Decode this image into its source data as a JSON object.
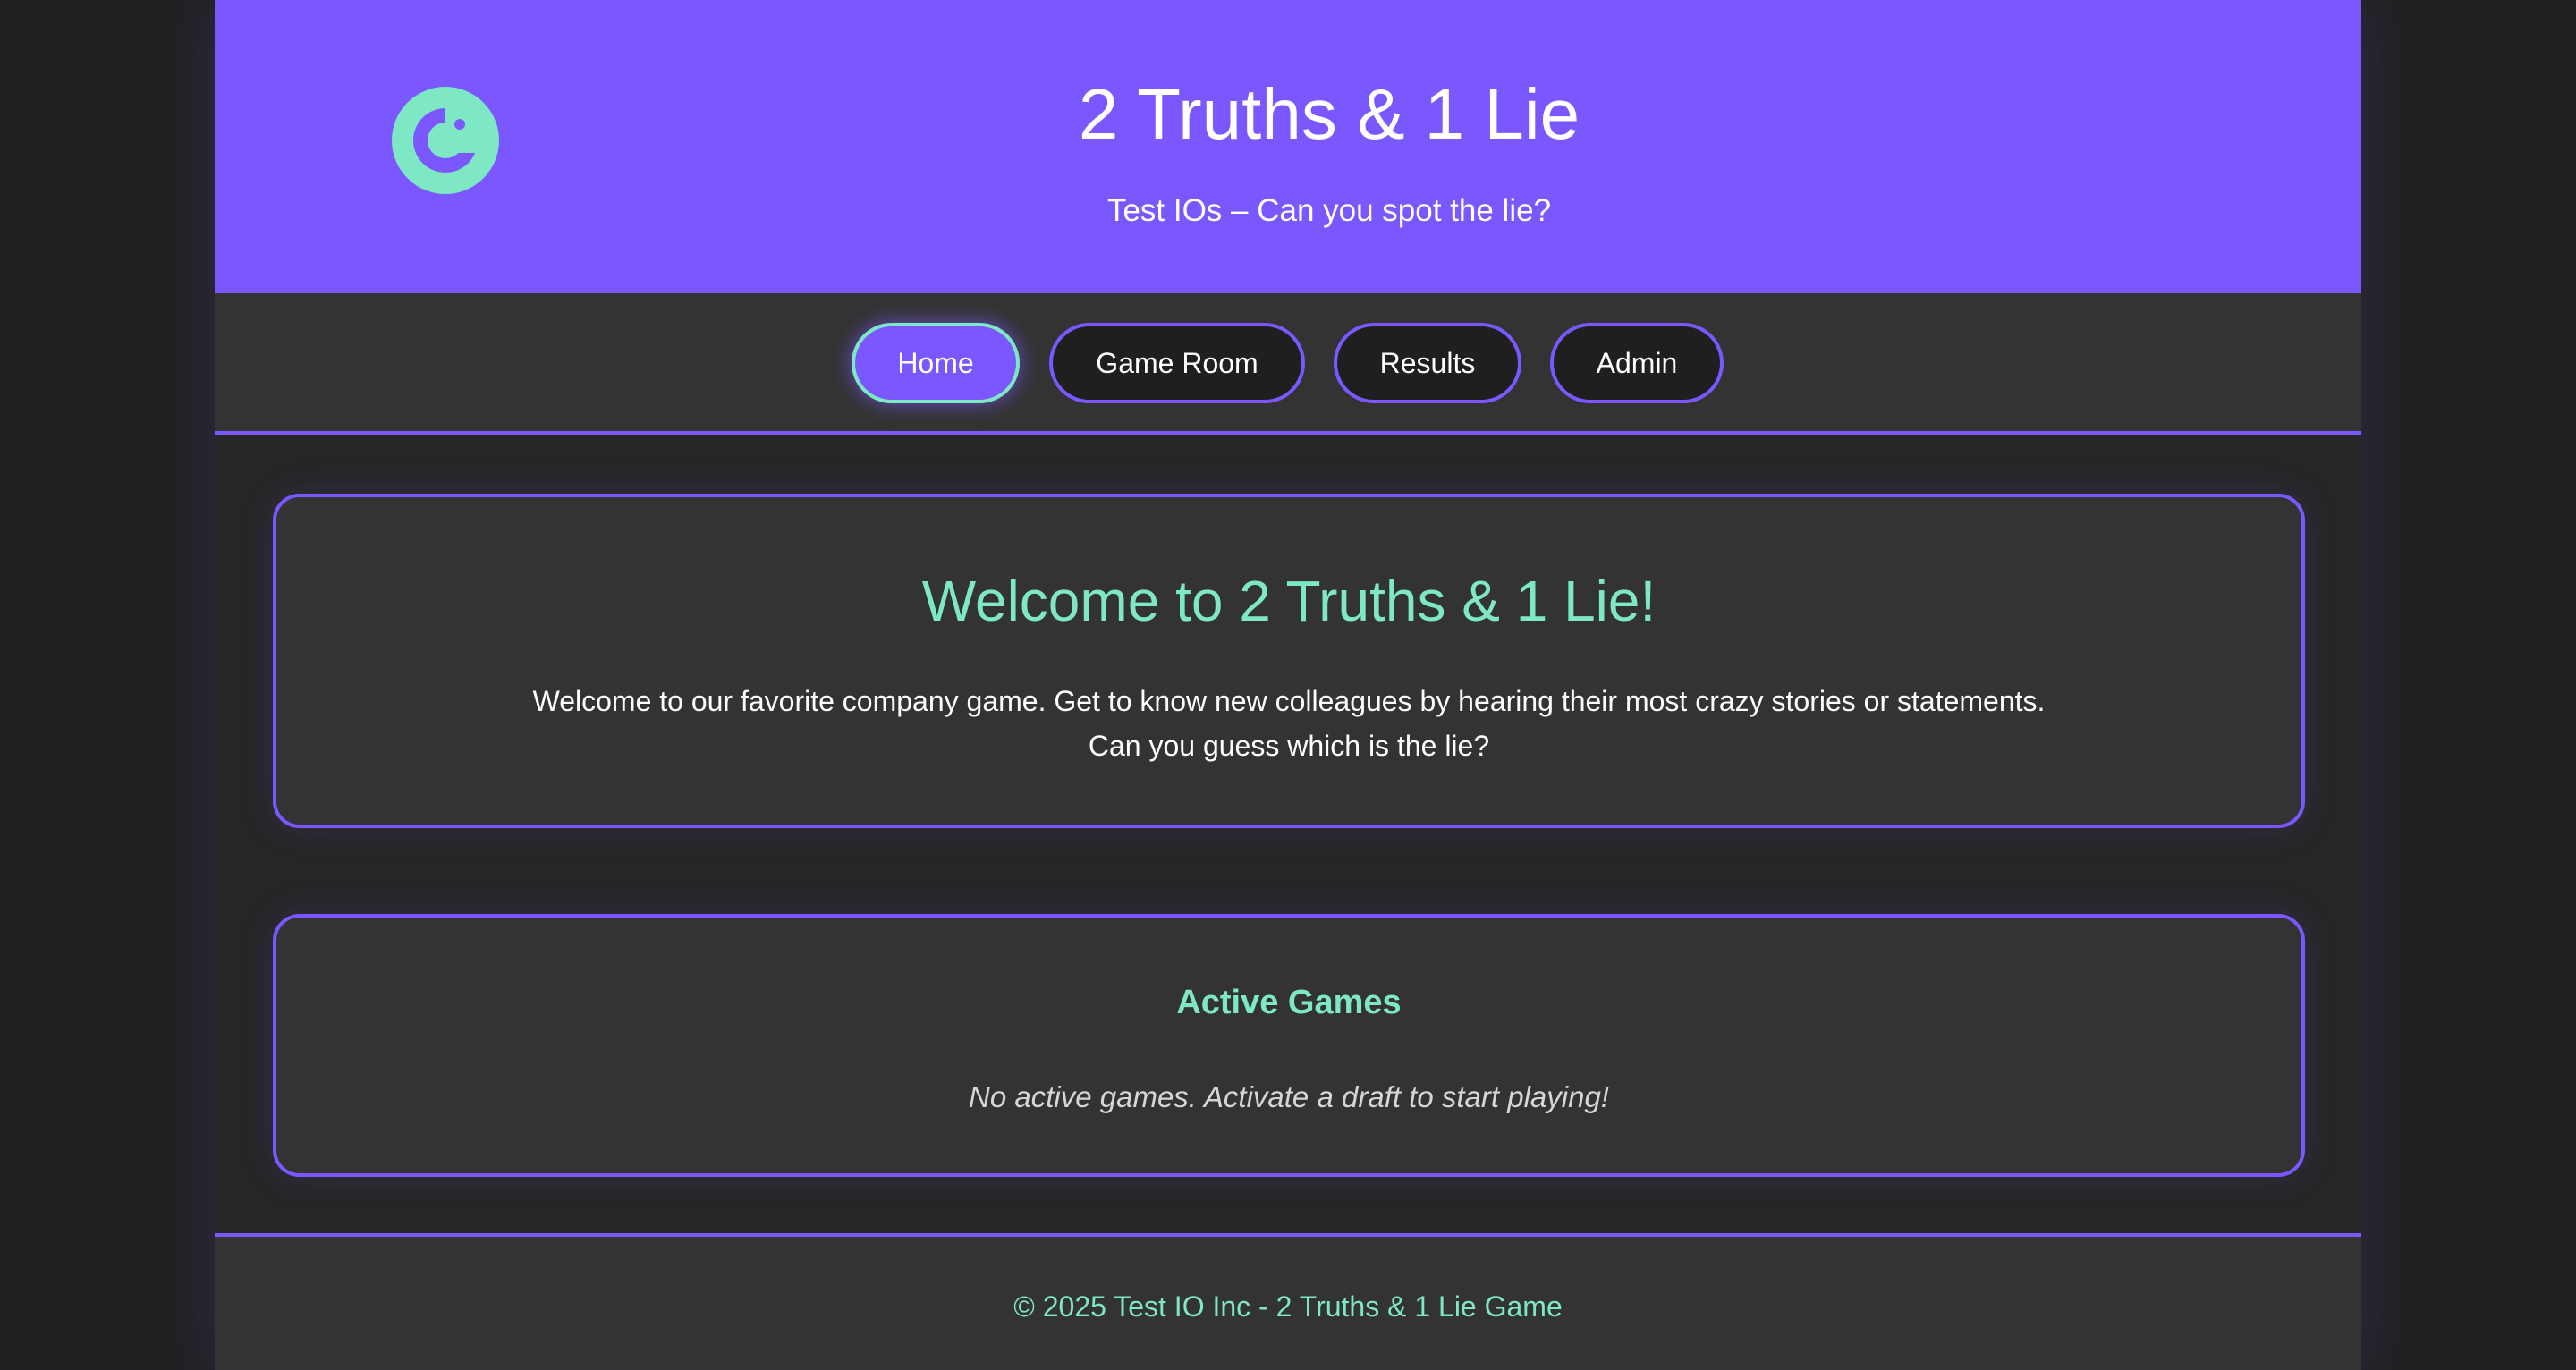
{
  "header": {
    "title": "2 Truths & 1 Lie",
    "subtitle": "Test IOs – Can you spot the lie?",
    "logo_icon": "test-io-logo-icon"
  },
  "nav": {
    "items": [
      {
        "label": "Home",
        "active": true
      },
      {
        "label": "Game Room",
        "active": false
      },
      {
        "label": "Results",
        "active": false
      },
      {
        "label": "Admin",
        "active": false
      }
    ]
  },
  "welcome": {
    "title": "Welcome to 2 Truths & 1 Lie!",
    "line1": "Welcome to our favorite company game. Get to know new colleagues by hearing their most crazy stories or statements.",
    "line2": "Can you guess which is the lie?"
  },
  "active_games": {
    "title": "Active Games",
    "empty_message": "No active games. Activate a draft to start playing!"
  },
  "footer": {
    "text": "© 2025 Test IO Inc - 2 Truths & 1 Lie Game"
  },
  "colors": {
    "accent_purple": "#7b57ff",
    "accent_mint": "#7de8c3",
    "background": "#212121",
    "panel": "#333333"
  }
}
